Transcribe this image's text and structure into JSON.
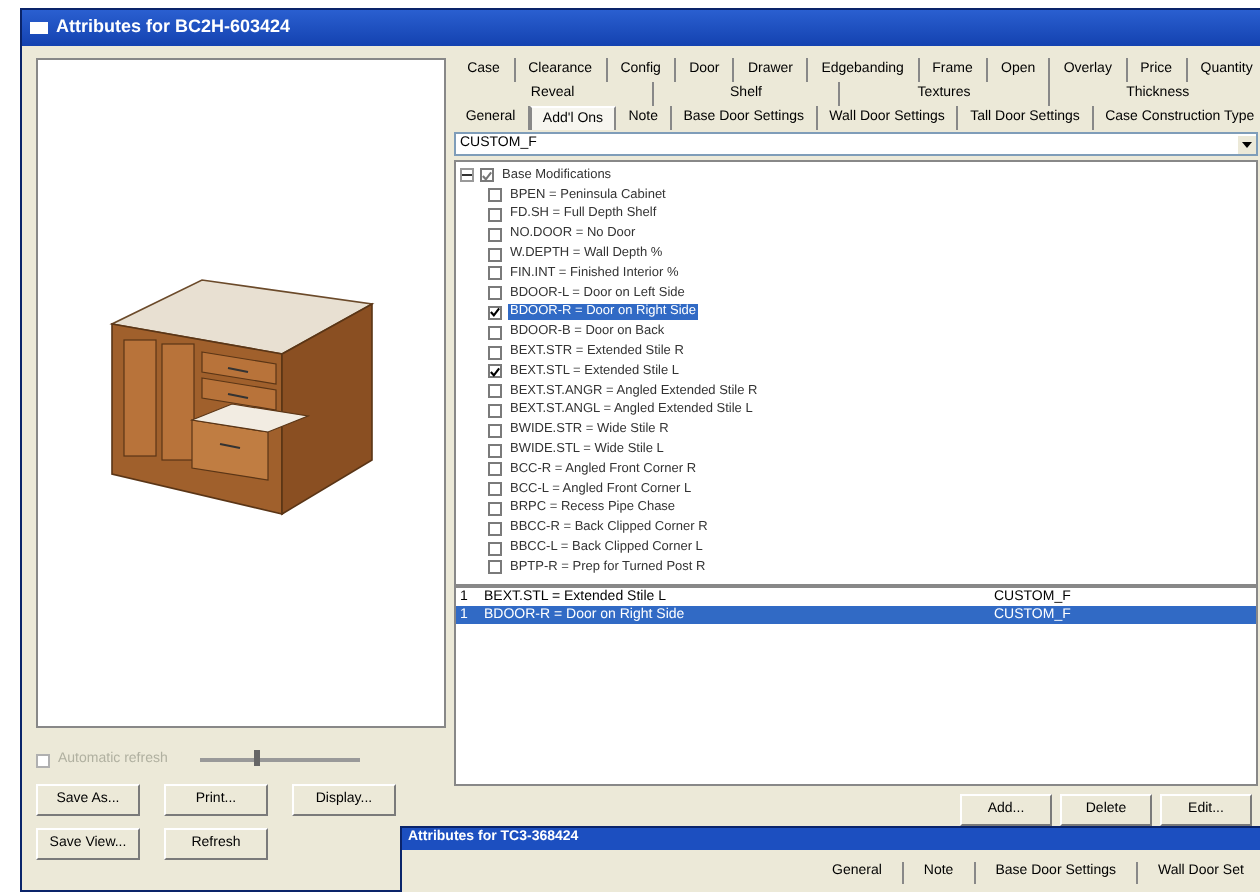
{
  "window": {
    "title": "Attributes for BC2H-603424"
  },
  "tab_rows": [
    [
      {
        "label": "Case",
        "selected": false
      },
      {
        "label": "Clearance",
        "selected": false
      },
      {
        "label": "Config",
        "selected": false
      },
      {
        "label": "Door",
        "selected": false
      },
      {
        "label": "Drawer",
        "selected": false
      },
      {
        "label": "Edgebanding",
        "selected": false
      },
      {
        "label": "Frame",
        "selected": false
      },
      {
        "label": "Open",
        "selected": false
      },
      {
        "label": "Overlay",
        "selected": false
      },
      {
        "label": "Price",
        "selected": false
      },
      {
        "label": "Quantity",
        "selected": false
      }
    ],
    [
      {
        "label": "Reveal",
        "selected": false
      },
      {
        "label": "Shelf",
        "selected": false
      },
      {
        "label": "Textures",
        "selected": false
      },
      {
        "label": "Thickness",
        "selected": false
      }
    ],
    [
      {
        "label": "General",
        "selected": false
      },
      {
        "label": "Add'l Ons",
        "selected": true
      },
      {
        "label": "Note",
        "selected": false
      },
      {
        "label": "Base Door Settings",
        "selected": false
      },
      {
        "label": "Wall Door Settings",
        "selected": false
      },
      {
        "label": "Tall Door Settings",
        "selected": false
      },
      {
        "label": "Case Construction Type",
        "selected": false
      }
    ]
  ],
  "combo": {
    "value": "CUSTOM_F"
  },
  "tree": [
    {
      "label": "Base Modifications",
      "checked": true,
      "expanded": true,
      "children": [
        {
          "label": "BPEN = Peninsula Cabinet",
          "checked": false,
          "selected": false
        },
        {
          "label": "FD.SH = Full Depth Shelf",
          "checked": false,
          "selected": false
        },
        {
          "label": "NO.DOOR = No Door",
          "checked": false,
          "selected": false
        },
        {
          "label": "W.DEPTH = Wall Depth %",
          "checked": false,
          "selected": false
        },
        {
          "label": "FIN.INT = Finished Interior %",
          "checked": false,
          "selected": false
        },
        {
          "label": "BDOOR-L = Door on Left Side",
          "checked": false,
          "selected": false
        },
        {
          "label": "BDOOR-R = Door on Right Side",
          "checked": true,
          "selected": true
        },
        {
          "label": "BDOOR-B = Door on Back",
          "checked": false,
          "selected": false
        },
        {
          "label": "BEXT.STR = Extended Stile R",
          "checked": false,
          "selected": false
        },
        {
          "label": "BEXT.STL = Extended Stile L",
          "checked": true,
          "selected": false
        },
        {
          "label": "BEXT.ST.ANGR = Angled Extended Stile R",
          "checked": false,
          "selected": false
        },
        {
          "label": "BEXT.ST.ANGL = Angled Extended Stile L",
          "checked": false,
          "selected": false
        },
        {
          "label": "BWIDE.STR = Wide Stile R",
          "checked": false,
          "selected": false
        },
        {
          "label": "BWIDE.STL = Wide Stile L",
          "checked": false,
          "selected": false
        },
        {
          "label": "BCC-R = Angled Front Corner R",
          "checked": false,
          "selected": false
        },
        {
          "label": "BCC-L = Angled Front Corner L",
          "checked": false,
          "selected": false
        },
        {
          "label": "BRPC = Recess Pipe Chase",
          "checked": false,
          "selected": false
        },
        {
          "label": "BBCC-R = Back Clipped Corner R",
          "checked": false,
          "selected": false
        },
        {
          "label": "BBCC-L = Back Clipped Corner L",
          "checked": false,
          "selected": false
        },
        {
          "label": "BPTP-R = Prep for Turned Post R",
          "checked": false,
          "selected": false
        }
      ]
    }
  ],
  "list_rows": [
    {
      "qty": "1",
      "item": "BEXT.STL = Extended Stile L",
      "source": "CUSTOM_F",
      "selected": false
    },
    {
      "qty": "1",
      "item": "BDOOR-R = Door on Right Side",
      "source": "CUSTOM_F",
      "selected": true
    }
  ],
  "list_buttons": [
    "Add...",
    "Delete",
    "Edit..."
  ],
  "auto_refresh": {
    "label": "Automatic refresh",
    "checked": false,
    "disabled": true
  },
  "zoom_slider": {
    "level": 0.35
  },
  "left_buttons": [
    [
      "Save As...",
      "Print...",
      "Display..."
    ],
    [
      "Save View...",
      "Refresh"
    ]
  ],
  "second_window": {
    "title": "Attributes for TC3-368424",
    "tabs": [
      "General",
      "Note",
      "Base Door Settings",
      "Wall Door Set"
    ]
  }
}
